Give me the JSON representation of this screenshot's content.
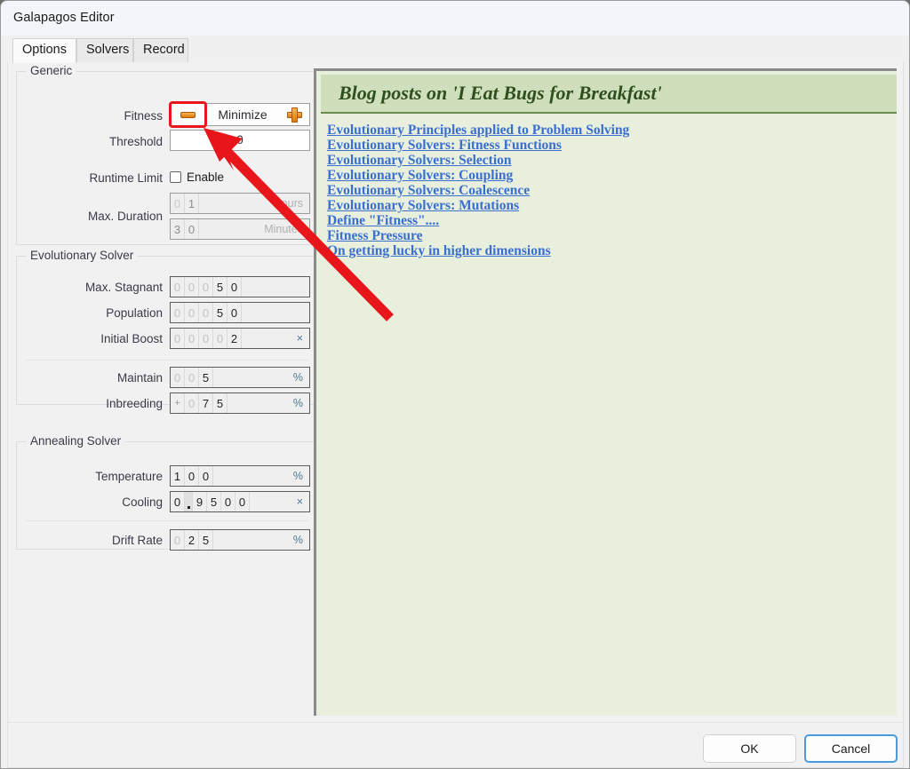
{
  "window": {
    "title": "Galapagos Editor"
  },
  "tabs": [
    {
      "label": "Options",
      "active": true
    },
    {
      "label": "Solvers",
      "active": false
    },
    {
      "label": "Record",
      "active": false
    }
  ],
  "groups": {
    "generic": {
      "legend": "Generic",
      "fitness": {
        "label": "Fitness",
        "minus_icon": "minus-icon",
        "value": "Minimize",
        "plus_icon": "plus-icon",
        "highlight_color": "#e8161a"
      },
      "threshold": {
        "label": "Threshold",
        "value": "0"
      },
      "runtime_limit": {
        "label": "Runtime Limit",
        "checkbox_label": "Enable",
        "checked": false
      },
      "max_duration": {
        "label": "Max. Duration",
        "hours": {
          "digits": [
            "0",
            "1"
          ],
          "pad": [
            true,
            false
          ],
          "unit": "Hours"
        },
        "minutes": {
          "digits": [
            "3",
            "0"
          ],
          "pad": [
            false,
            false
          ],
          "unit": "Minutes"
        }
      }
    },
    "evolutionary": {
      "legend": "Evolutionary Solver",
      "rows": [
        {
          "label": "Max. Stagnant",
          "digits": [
            "0",
            "0",
            "0",
            "5",
            "0"
          ],
          "pad": [
            true,
            true,
            true,
            false,
            false
          ],
          "unit": ""
        },
        {
          "label": "Population",
          "digits": [
            "0",
            "0",
            "0",
            "5",
            "0"
          ],
          "pad": [
            true,
            true,
            true,
            false,
            false
          ],
          "unit": ""
        },
        {
          "label": "Initial Boost",
          "digits": [
            "0",
            "0",
            "0",
            "0",
            "2"
          ],
          "pad": [
            true,
            true,
            true,
            true,
            false
          ],
          "unit": "×"
        },
        {
          "label": "Maintain",
          "digits": [
            "0",
            "0",
            "5"
          ],
          "pad": [
            true,
            true,
            false
          ],
          "unit": "%"
        },
        {
          "label": "Inbreeding",
          "sign": "+",
          "digits": [
            "0",
            "7",
            "5"
          ],
          "pad": [
            true,
            false,
            false
          ],
          "unit": "%"
        }
      ]
    },
    "annealing": {
      "legend": "Annealing Solver",
      "rows": [
        {
          "label": "Temperature",
          "digits": [
            "1",
            "0",
            "0"
          ],
          "pad": [
            false,
            false,
            false
          ],
          "unit": "%"
        },
        {
          "label": "Cooling",
          "digits": [
            "0",
            ".",
            "9",
            "5",
            "0",
            "0"
          ],
          "pad": [
            false,
            false,
            false,
            false,
            false,
            false
          ],
          "unit": "×"
        },
        {
          "label": "Drift Rate",
          "digits": [
            "0",
            "2",
            "5"
          ],
          "pad": [
            true,
            false,
            false
          ],
          "unit": "%"
        }
      ]
    }
  },
  "blog": {
    "header": "Blog posts on 'I Eat Bugs for Breakfast'",
    "links": [
      "Evolutionary Principles applied to Problem Solving",
      "Evolutionary Solvers: Fitness Functions",
      "Evolutionary Solvers: Selection",
      "Evolutionary Solvers: Coupling",
      "Evolutionary Solvers: Coalescence",
      "Evolutionary Solvers: Mutations",
      "Define \"Fitness\"....",
      "Fitness Pressure",
      "On getting lucky in higher dimensions"
    ],
    "header_bg": "#cfdfbc",
    "body_bg": "#e8efdd",
    "link_color": "#3a6fd0"
  },
  "footer": {
    "ok_label": "OK",
    "cancel_label": "Cancel"
  },
  "annotation": {
    "arrow_color": "#e8161a"
  }
}
